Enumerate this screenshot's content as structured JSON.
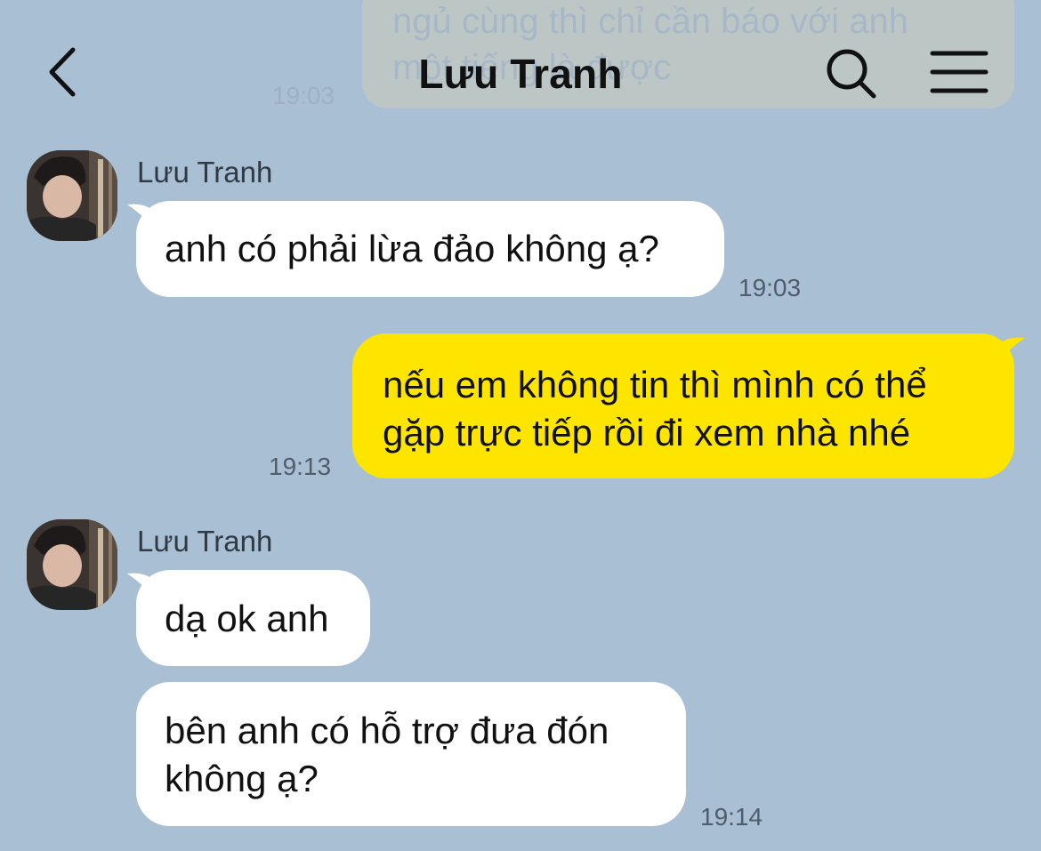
{
  "header": {
    "title": "Lưu Tranh"
  },
  "previous_message": {
    "text": "ngủ cùng thì chỉ cần báo với anh\nmột tiếng là được",
    "time": "19:03"
  },
  "messages": [
    {
      "sender": "Lưu Tranh",
      "direction": "incoming",
      "text": "anh có phải lừa đảo không ạ?",
      "time": "19:03"
    },
    {
      "direction": "outgoing",
      "text": "nếu em không tin thì mình có thể\ngặp trực tiếp rồi đi xem nhà nhé",
      "time": "19:13"
    },
    {
      "sender": "Lưu Tranh",
      "direction": "incoming",
      "text": "dạ ok anh",
      "time": ""
    },
    {
      "direction": "incoming",
      "text": "bên anh có hỗ trợ đưa đón\nkhông ạ?",
      "time": "19:14"
    }
  ],
  "colors": {
    "background": "#a9bfd3",
    "incoming_bubble": "#ffffff",
    "outgoing_bubble": "#fee500"
  },
  "icons": {
    "back": "chevron-left-icon",
    "search": "search-icon",
    "menu": "hamburger-menu-icon"
  }
}
